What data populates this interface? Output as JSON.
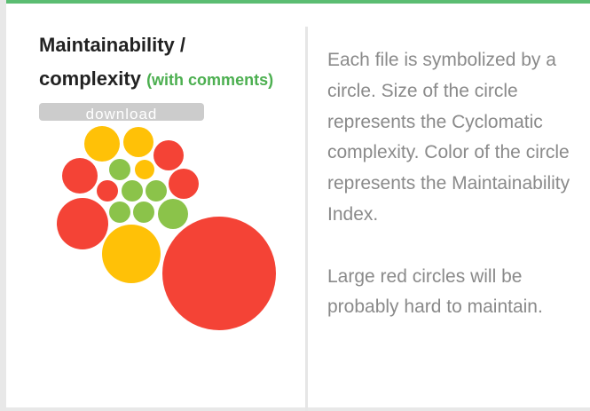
{
  "panel": {
    "title_line1": "Maintainability /",
    "title_line2": "complexity",
    "title_suffix": "(with comments)",
    "download_label": "download"
  },
  "description": {
    "paragraph1": "Each file is symbolized by a circle. Size of the circle represents the Cyclomatic complexity. Color of the circle represents the Maintainability Index.",
    "paragraph2": "Large red circles will be probably hard to maintain."
  },
  "colors": {
    "high": "#f44336",
    "medium": "#ffc107",
    "low": "#8bc34a",
    "accent": "#5bbd72"
  }
}
